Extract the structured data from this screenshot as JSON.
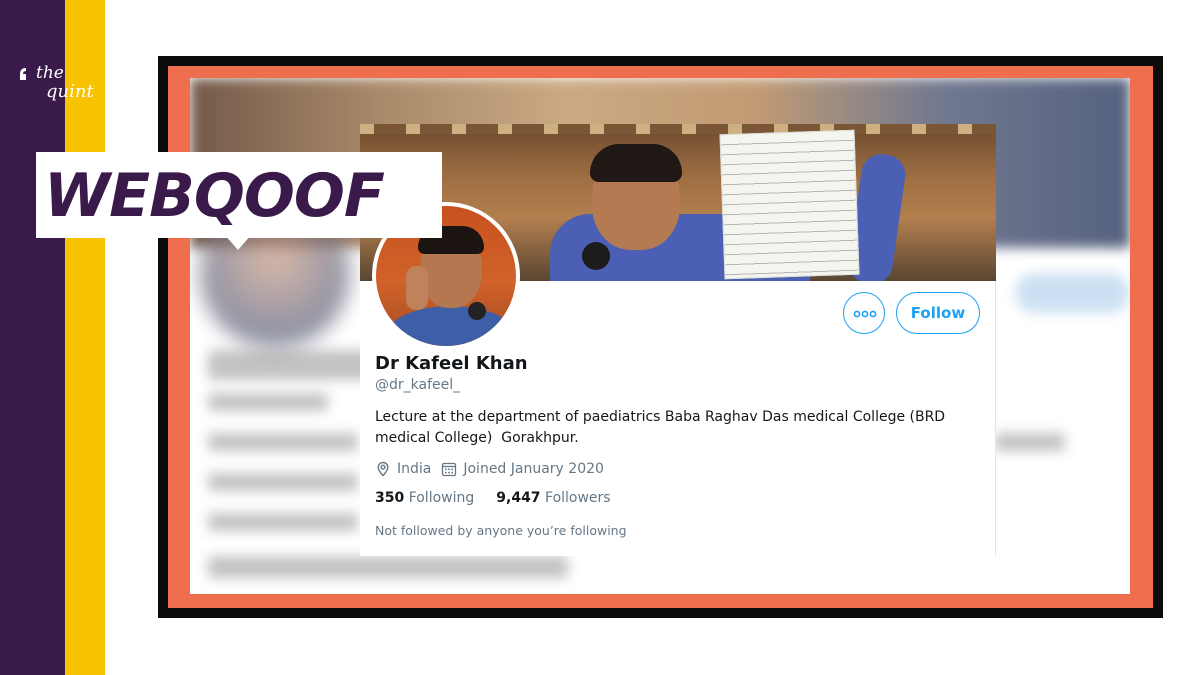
{
  "brand": {
    "logo_line1": "the",
    "logo_line2": "quint",
    "badge": "WEBQOOF",
    "colors": {
      "purple": "#3a1a4a",
      "yellow": "#f7c200",
      "orange": "#ee6e4d",
      "twitter_blue": "#1da1f2"
    }
  },
  "profile": {
    "name": "Dr Kafeel Khan",
    "handle": "@dr_kafeel_",
    "bio": "Lecture at the department of paediatrics Baba Raghav Das medical College (BRD\nmedical College)  Gorakhpur.",
    "location": "India",
    "joined": "Joined January 2020",
    "following_count": "350",
    "following_label": "Following",
    "followers_count": "9,447",
    "followers_label": "Followers",
    "not_followed_note": "Not followed by anyone you’re following"
  },
  "actions": {
    "follow_label": "Follow",
    "more_icon": "more-options-icon"
  },
  "icons": {
    "location": "location-pin-icon",
    "calendar": "calendar-icon"
  }
}
